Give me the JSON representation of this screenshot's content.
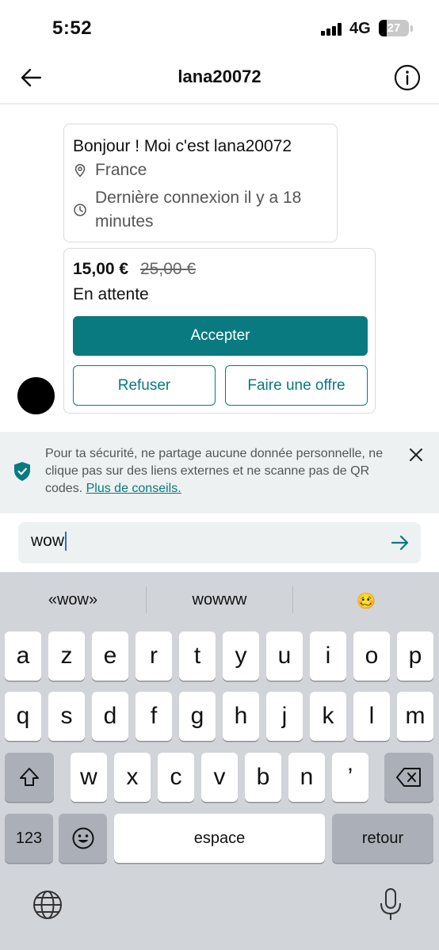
{
  "status_bar": {
    "time": "5:52",
    "network": "4G",
    "battery": "27",
    "battery_level": 0.27
  },
  "header": {
    "title": "lana20072",
    "back_icon": "arrow-left-icon",
    "info_icon": "info-icon"
  },
  "profile": {
    "greeting": "Bonjour ! Moi c'est lana20072",
    "location": "France",
    "last_seen_line1": "Dernière connexion il y a 18",
    "last_seen_line2": "minutes"
  },
  "offer": {
    "price": "15,00 €",
    "original_price": "25,00 €",
    "status": "En attente",
    "accept_label": "Accepter",
    "refuse_label": "Refuser",
    "counter_label": "Faire une offre"
  },
  "safety": {
    "text": "Pour ta sécurité, ne partage aucune donnée personnelle, ne clique pas sur des liens externes et ne scanne pas de QR codes. ",
    "link": "Plus de conseils."
  },
  "composer": {
    "value": "wow",
    "send_icon": "arrow-right-icon"
  },
  "keyboard": {
    "suggestions": [
      "«wow»",
      "wowww",
      "🥴"
    ],
    "row1": [
      "a",
      "z",
      "e",
      "r",
      "t",
      "y",
      "u",
      "i",
      "o",
      "p"
    ],
    "row2": [
      "q",
      "s",
      "d",
      "f",
      "g",
      "h",
      "j",
      "k",
      "l",
      "m"
    ],
    "row3": [
      "w",
      "x",
      "c",
      "v",
      "b",
      "n",
      "’"
    ],
    "numbers_label": "123",
    "space_label": "espace",
    "return_label": "retour"
  },
  "colors": {
    "accent": "#087a80",
    "banner_bg": "#edf1f2",
    "keyboard_bg": "#d1d4d9"
  }
}
